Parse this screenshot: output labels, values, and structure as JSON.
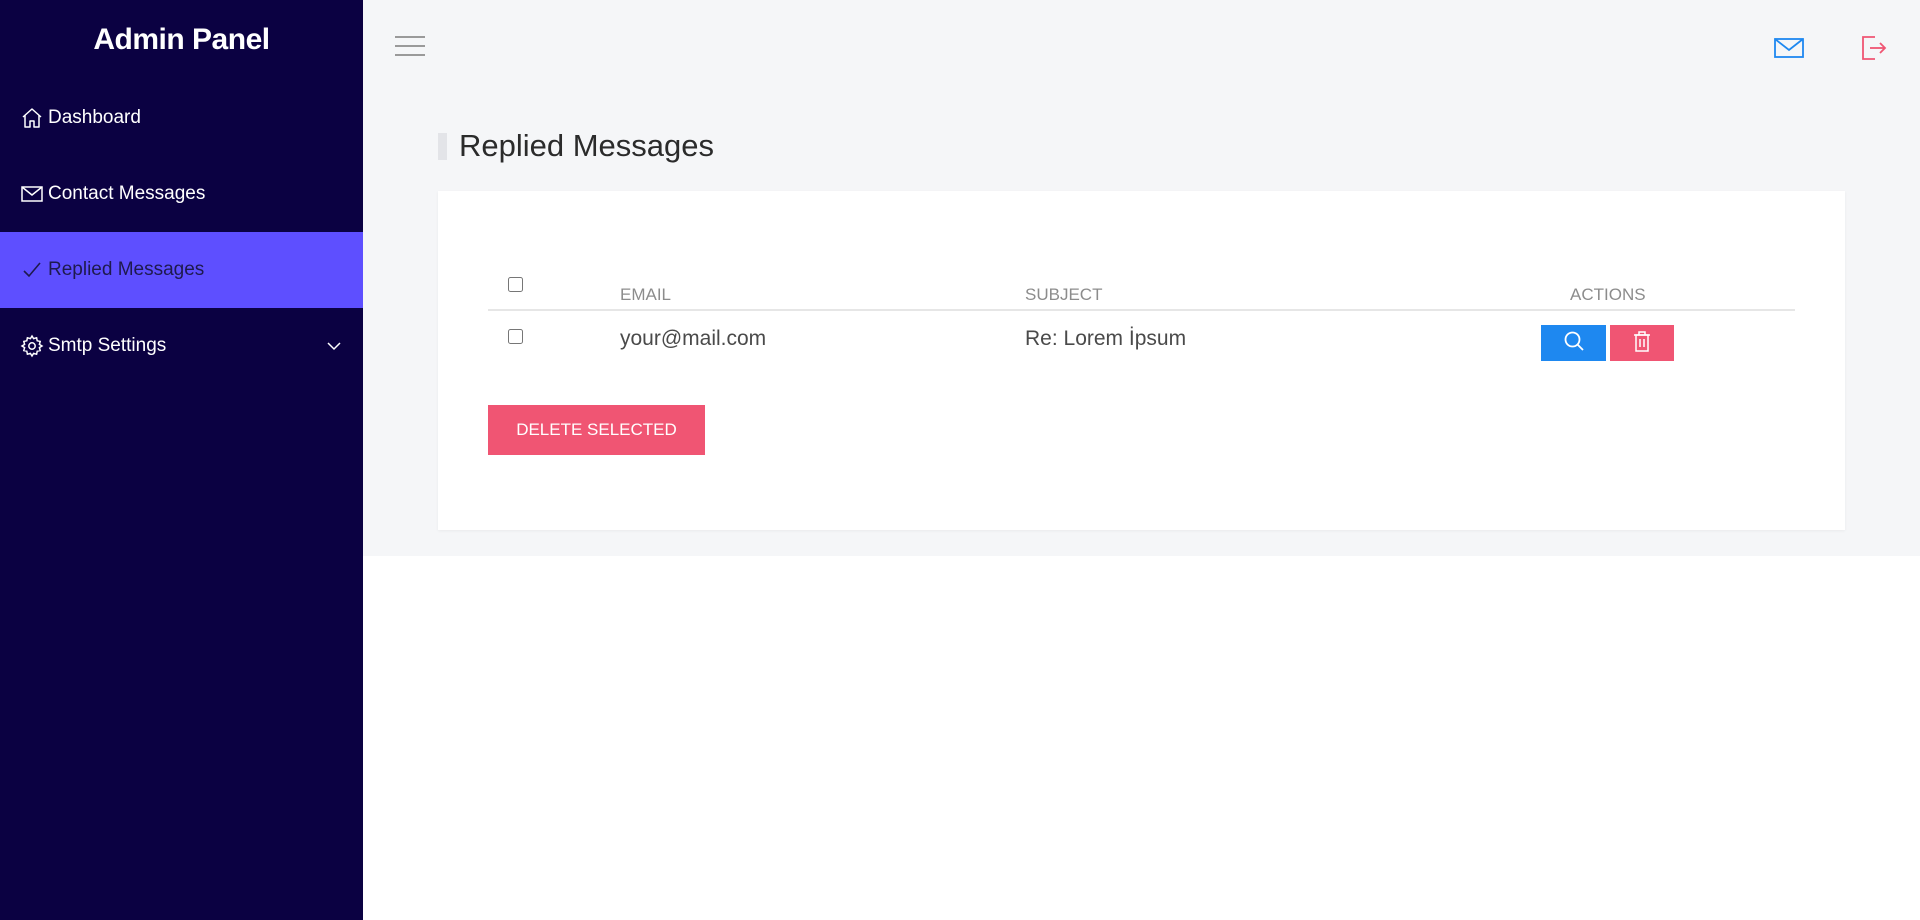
{
  "brand": "Admin Panel",
  "sidebar": {
    "items": [
      {
        "label": "Dashboard",
        "icon": "home-icon"
      },
      {
        "label": "Contact Messages",
        "icon": "mail-icon"
      },
      {
        "label": "Replied Messages",
        "icon": "check-icon",
        "active": true
      },
      {
        "label": "Smtp Settings",
        "icon": "gear-icon",
        "expandable": true
      }
    ]
  },
  "header": {
    "menu_icon": "hamburger-icon",
    "mail_icon": "mail-icon",
    "logout_icon": "logout-icon"
  },
  "main": {
    "title": "Replied Messages",
    "table": {
      "columns": [
        "EMAIL",
        "SUBJECT",
        "ACTIONS"
      ],
      "rows": [
        {
          "email": "your@mail.com",
          "subject": "Re: Lorem İpsum"
        }
      ]
    },
    "delete_selected_label": "DELETE SELECTED"
  },
  "colors": {
    "sidebar_bg": "#0b0142",
    "active_item": "#5e4fff",
    "primary_blue": "#1e88f0",
    "danger_pink": "#f05573",
    "content_bg": "#f5f6f8"
  }
}
